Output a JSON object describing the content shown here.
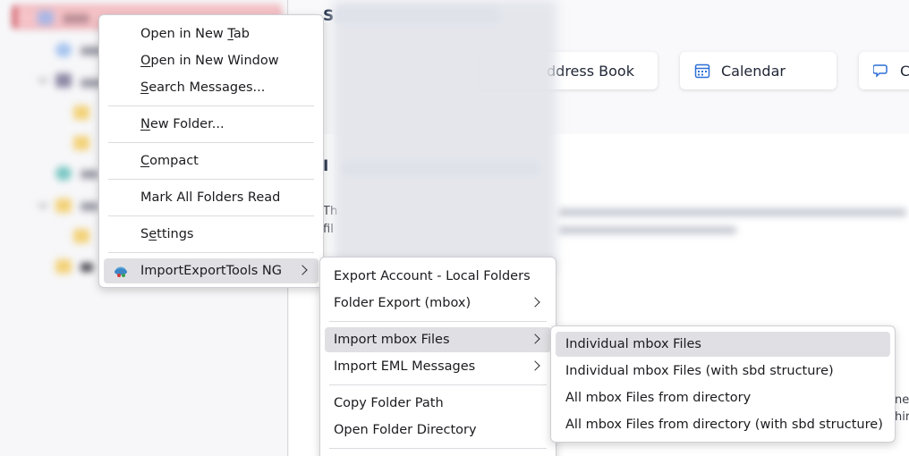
{
  "main": {
    "hub_title_initial": "S",
    "cards": [
      {
        "label": "ddress Book",
        "icon": "address-book-icon"
      },
      {
        "label": "Calendar",
        "icon": "calendar-icon"
      },
      {
        "label": "C",
        "icon": "chat-icon"
      }
    ],
    "import_heading_initial": "I",
    "para_line1_start": "Th",
    "para_line2_start": "fil",
    "right_cut_1": "ne",
    "right_cut_2": "hir"
  },
  "context_menu": {
    "items": [
      {
        "pre": "Open in New ",
        "u": "T",
        "post": "ab"
      },
      {
        "pre": "",
        "u": "O",
        "post": "pen in New Window"
      },
      {
        "pre": "",
        "u": "S",
        "post": "earch Messages..."
      },
      {
        "pre": "",
        "u": "N",
        "post": "ew Folder..."
      },
      {
        "pre": "",
        "u": "C",
        "post": "ompact"
      },
      {
        "pre": "Mark All Folders Read",
        "u": "",
        "post": ""
      },
      {
        "pre": "S",
        "u": "e",
        "post": "ttings"
      },
      {
        "pre": "ImportExportTools NG",
        "u": "",
        "post": ""
      }
    ]
  },
  "iet_menu": {
    "items": [
      "Export Account - Local Folders",
      "Folder Export (mbox)",
      "Import mbox Files",
      "Import EML Messages",
      "Copy Folder Path",
      "Open Folder Directory"
    ]
  },
  "mbox_menu": {
    "items": [
      "Individual mbox Files",
      "Individual mbox Files (with sbd structure)",
      "All mbox Files from directory",
      "All mbox Files from directory (with sbd structure)"
    ]
  },
  "colors": {
    "selected_folder_bg": "#f5c3c8",
    "selected_folder_accent": "#c22d3a",
    "menu_highlight": "#e0e0e4",
    "card_icon_blue": "#2d6fd6"
  }
}
